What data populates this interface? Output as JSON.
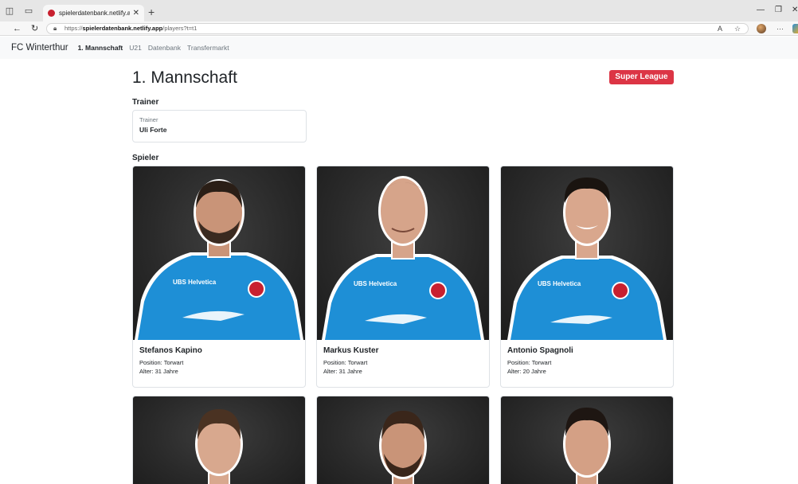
{
  "browser": {
    "tab_title": "spielerdatenbank.netlify.app/play",
    "url_prefix": "https://",
    "url_host": "spielerdatenbank.netlify.app",
    "url_path": "/players?t=t1"
  },
  "navbar": {
    "brand": "FC Winterthur",
    "links": [
      "1. Mannschaft",
      "U21",
      "Datenbank",
      "Transfermarkt"
    ]
  },
  "page": {
    "title": "1. Mannschaft",
    "league_badge": "Super League",
    "trainer_heading": "Trainer",
    "trainer_label": "Trainer",
    "trainer_name": "Uli Forte",
    "players_heading": "Spieler"
  },
  "players": [
    {
      "name": "Stefanos Kapino",
      "position": "Position: Torwart",
      "age": "Alter: 31 Jahre"
    },
    {
      "name": "Markus Kuster",
      "position": "Position: Torwart",
      "age": "Alter: 31 Jahre"
    },
    {
      "name": "Antonio Spagnoli",
      "position": "Position: Torwart",
      "age": "Alter: 20 Jahre"
    }
  ],
  "jersey": {
    "sponsor": "UBS Helvetica"
  },
  "colors": {
    "badge": "#dc3545",
    "jersey": "#1e8fd6",
    "photo_bg": "#2a2a2a"
  }
}
